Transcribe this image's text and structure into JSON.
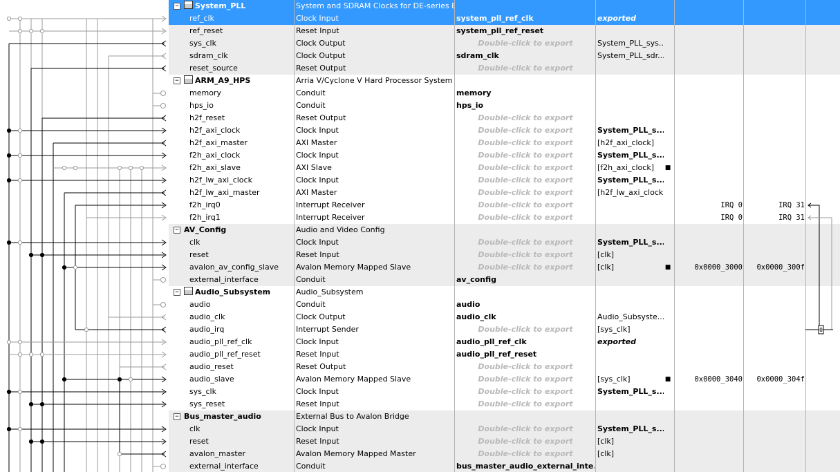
{
  "rows": [
    {
      "type": "comp",
      "name": "System_PLL",
      "desc": "System and SDRAM Clocks for DE-series Boards",
      "selected": true,
      "band": "sel",
      "icon": true
    },
    {
      "type": "port",
      "name": "ref_clk",
      "desc": "Clock Input",
      "export": "system_pll_ref_clk",
      "exportStyle": "bold",
      "clock": "exported",
      "clockStyle": "italicbold",
      "band": "sel"
    },
    {
      "type": "port",
      "name": "ref_reset",
      "desc": "Reset Input",
      "export": "system_pll_ref_reset",
      "exportStyle": "bold",
      "band": "gray"
    },
    {
      "type": "port",
      "name": "sys_clk",
      "desc": "Clock Output",
      "export": "Double-click to export",
      "exportStyle": "hint",
      "clock": "System_PLL_sys...",
      "band": "gray"
    },
    {
      "type": "port",
      "name": "sdram_clk",
      "desc": "Clock Output",
      "export": "sdram_clk",
      "exportStyle": "bold",
      "clock": "System_PLL_sdr...",
      "band": "gray"
    },
    {
      "type": "port",
      "name": "reset_source",
      "desc": "Reset Output",
      "export": "Double-click to export",
      "exportStyle": "hint",
      "band": "gray"
    },
    {
      "type": "comp",
      "name": "ARM_A9_HPS",
      "desc": "Arria V/Cyclone V Hard Processor System",
      "band": "white",
      "icon": true
    },
    {
      "type": "port",
      "name": "memory",
      "desc": "Conduit",
      "export": "memory",
      "exportStyle": "bold",
      "band": "white"
    },
    {
      "type": "port",
      "name": "hps_io",
      "desc": "Conduit",
      "export": "hps_io",
      "exportStyle": "bold",
      "band": "white"
    },
    {
      "type": "port",
      "name": "h2f_reset",
      "desc": "Reset Output",
      "export": "Double-click to export",
      "exportStyle": "hint",
      "band": "white"
    },
    {
      "type": "port",
      "name": "h2f_axi_clock",
      "desc": "Clock Input",
      "export": "Double-click to export",
      "exportStyle": "hint",
      "clock": "System_PLL_s...",
      "clockStyle": "bold",
      "band": "white"
    },
    {
      "type": "port",
      "name": "h2f_axi_master",
      "desc": "AXI Master",
      "export": "Double-click to export",
      "exportStyle": "hint",
      "clock": "[h2f_axi_clock]",
      "band": "white"
    },
    {
      "type": "port",
      "name": "f2h_axi_clock",
      "desc": "Clock Input",
      "export": "Double-click to export",
      "exportStyle": "hint",
      "clock": "System_PLL_s...",
      "clockStyle": "bold",
      "band": "white"
    },
    {
      "type": "port",
      "name": "f2h_axi_slave",
      "desc": "AXI Slave",
      "export": "Double-click to export",
      "exportStyle": "hint",
      "clock": "[f2h_axi_clock]",
      "lock": true,
      "band": "white"
    },
    {
      "type": "port",
      "name": "h2f_lw_axi_clock",
      "desc": "Clock Input",
      "export": "Double-click to export",
      "exportStyle": "hint",
      "clock": "System_PLL_s...",
      "clockStyle": "bold",
      "band": "white"
    },
    {
      "type": "port",
      "name": "h2f_lw_axi_master",
      "desc": "AXI Master",
      "export": "Double-click to export",
      "exportStyle": "hint",
      "clock": "[h2f_lw_axi_clock]",
      "band": "white"
    },
    {
      "type": "port",
      "name": "f2h_irq0",
      "desc": "Interrupt Receiver",
      "export": "Double-click to export",
      "exportStyle": "hint",
      "base": "IRQ 0",
      "end": "IRQ 31",
      "band": "white"
    },
    {
      "type": "port",
      "name": "f2h_irq1",
      "desc": "Interrupt Receiver",
      "export": "Double-click to export",
      "exportStyle": "hint",
      "base": "IRQ 0",
      "end": "IRQ 31",
      "band": "white"
    },
    {
      "type": "comp",
      "name": "AV_Config",
      "desc": "Audio and Video Config",
      "band": "gray",
      "icon": false
    },
    {
      "type": "port",
      "name": "clk",
      "desc": "Clock Input",
      "export": "Double-click to export",
      "exportStyle": "hint",
      "clock": "System_PLL_s...",
      "clockStyle": "bold",
      "band": "gray"
    },
    {
      "type": "port",
      "name": "reset",
      "desc": "Reset Input",
      "export": "Double-click to export",
      "exportStyle": "hint",
      "clock": "[clk]",
      "band": "gray"
    },
    {
      "type": "port",
      "name": "avalon_av_config_slave",
      "desc": "Avalon Memory Mapped Slave",
      "export": "Double-click to export",
      "exportStyle": "hint",
      "clock": "[clk]",
      "lock": true,
      "base": "0x0000_3000",
      "end": "0x0000_300f",
      "band": "gray"
    },
    {
      "type": "port",
      "name": "external_interface",
      "desc": "Conduit",
      "export": "av_config",
      "exportStyle": "bold",
      "band": "gray"
    },
    {
      "type": "comp",
      "name": "Audio_Subsystem",
      "desc": "Audio_Subsystem",
      "band": "white",
      "icon": true
    },
    {
      "type": "port",
      "name": "audio",
      "desc": "Conduit",
      "export": "audio",
      "exportStyle": "bold",
      "band": "white"
    },
    {
      "type": "port",
      "name": "audio_clk",
      "desc": "Clock Output",
      "export": "audio_clk",
      "exportStyle": "bold",
      "clock": "Audio_Subsyste...",
      "band": "white"
    },
    {
      "type": "port",
      "name": "audio_irq",
      "desc": "Interrupt Sender",
      "export": "Double-click to export",
      "exportStyle": "hint",
      "clock": "[sys_clk]",
      "band": "white"
    },
    {
      "type": "port",
      "name": "audio_pll_ref_clk",
      "desc": "Clock Input",
      "export": "audio_pll_ref_clk",
      "exportStyle": "bold",
      "clock": "exported",
      "clockStyle": "italicbold",
      "band": "white"
    },
    {
      "type": "port",
      "name": "audio_pll_ref_reset",
      "desc": "Reset Input",
      "export": "audio_pll_ref_reset",
      "exportStyle": "bold",
      "band": "white"
    },
    {
      "type": "port",
      "name": "audio_reset",
      "desc": "Reset Output",
      "export": "Double-click to export",
      "exportStyle": "hint",
      "band": "white"
    },
    {
      "type": "port",
      "name": "audio_slave",
      "desc": "Avalon Memory Mapped Slave",
      "export": "Double-click to export",
      "exportStyle": "hint",
      "clock": "[sys_clk]",
      "lock": true,
      "base": "0x0000_3040",
      "end": "0x0000_304f",
      "band": "white"
    },
    {
      "type": "port",
      "name": "sys_clk",
      "desc": "Clock Input",
      "export": "Double-click to export",
      "exportStyle": "hint",
      "clock": "System_PLL_s...",
      "clockStyle": "bold",
      "band": "white"
    },
    {
      "type": "port",
      "name": "sys_reset",
      "desc": "Reset Input",
      "export": "Double-click to export",
      "exportStyle": "hint",
      "band": "white"
    },
    {
      "type": "comp",
      "name": "Bus_master_audio",
      "desc": "External Bus to Avalon Bridge",
      "band": "gray",
      "icon": false
    },
    {
      "type": "port",
      "name": "clk",
      "desc": "Clock Input",
      "export": "Double-click to export",
      "exportStyle": "hint",
      "clock": "System_PLL_s...",
      "clockStyle": "bold",
      "band": "gray"
    },
    {
      "type": "port",
      "name": "reset",
      "desc": "Reset Input",
      "export": "Double-click to export",
      "exportStyle": "hint",
      "clock": "[clk]",
      "band": "gray"
    },
    {
      "type": "port",
      "name": "avalon_master",
      "desc": "Avalon Memory Mapped Master",
      "export": "Double-click to export",
      "exportStyle": "hint",
      "clock": "[clk]",
      "band": "gray"
    },
    {
      "type": "port",
      "name": "external_interface",
      "desc": "Conduit",
      "export": "bus_master_audio_external_inte...",
      "exportStyle": "bold",
      "band": "gray"
    }
  ]
}
